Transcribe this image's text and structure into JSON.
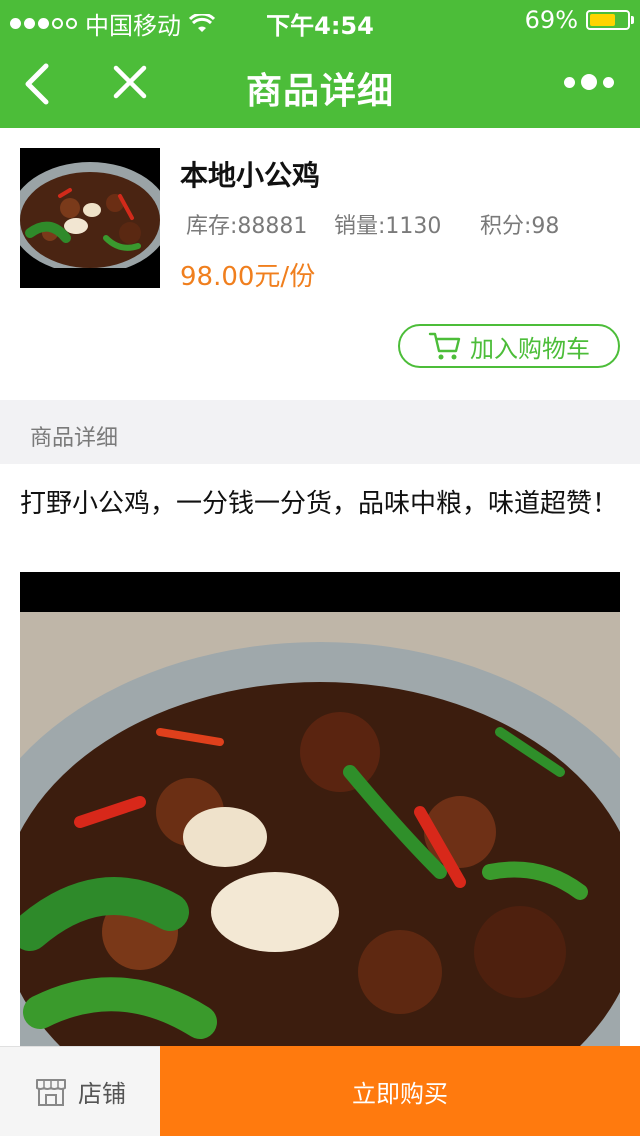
{
  "status_bar": {
    "carrier": "中国移动",
    "time": "下午4:54",
    "battery_percent": "69%",
    "battery_level": 0.69
  },
  "nav": {
    "title": "商品详细",
    "back_icon": "chevron-left-icon",
    "close_icon": "close-icon",
    "more_icon": "more-dots-icon"
  },
  "product": {
    "name": "本地小公鸡",
    "stock": "库存:88881",
    "sales": "销量:1130",
    "points": "积分:98",
    "price": "98.00元/份",
    "add_to_cart": "加入购物车"
  },
  "detail": {
    "section_title": "商品详细",
    "description": "打野小公鸡，一分钱一分货，品味中粮，味道超赞！"
  },
  "bottom_bar": {
    "shop_label": "店铺",
    "buy_label": "立即购买"
  },
  "colors": {
    "brand_green": "#4cbd39",
    "price_orange": "#f07f1e",
    "buy_orange": "#ff7a0e"
  }
}
